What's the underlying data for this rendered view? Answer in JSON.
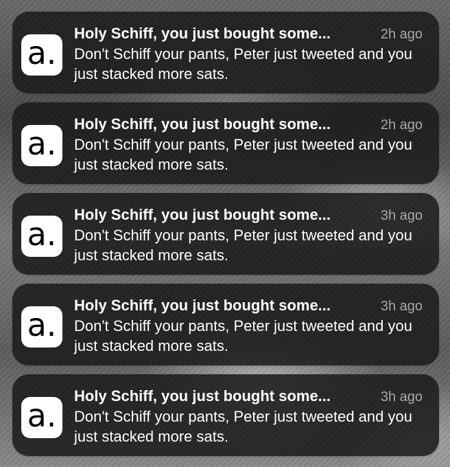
{
  "app": {
    "icon_name": "a-logo-icon",
    "icon_glyph": "a."
  },
  "notifications": [
    {
      "title": "Holy Schiff, you just bought some...",
      "time": "2h ago",
      "body": "Don't Schiff your pants, Peter just tweeted and you just stacked more sats."
    },
    {
      "title": "Holy Schiff, you just bought some...",
      "time": "2h ago",
      "body": "Don't Schiff your pants, Peter just tweeted and you just stacked more sats."
    },
    {
      "title": "Holy Schiff, you just bought some...",
      "time": "3h ago",
      "body": "Don't Schiff your pants, Peter just tweeted and you just stacked more sats."
    },
    {
      "title": "Holy Schiff, you just bought some...",
      "time": "3h ago",
      "body": "Don't Schiff your pants, Peter just tweeted and you just stacked more sats."
    },
    {
      "title": "Holy Schiff, you just bought some...",
      "time": "3h ago",
      "body": "Don't Schiff your pants, Peter just tweeted and you just stacked more sats."
    }
  ],
  "colors": {
    "card_background": "#1c1c1c",
    "title_text": "#ffffff",
    "time_text": "#a8a8a8",
    "icon_background": "#ffffff"
  }
}
